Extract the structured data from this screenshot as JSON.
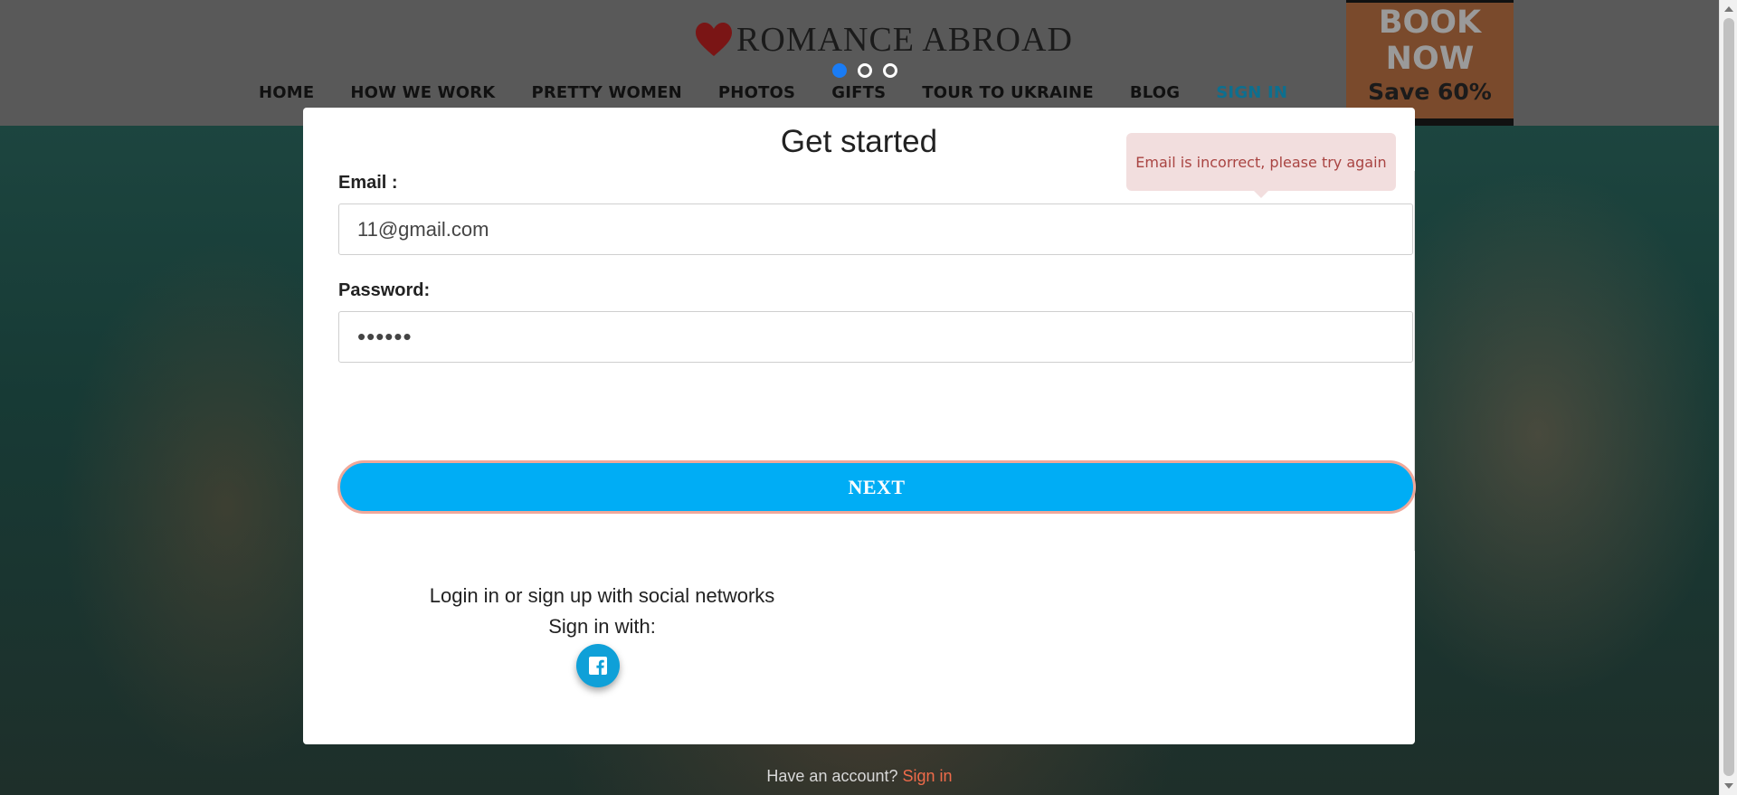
{
  "header": {
    "logo_text": "ROMANCE ABROAD",
    "carousel_dots": 3,
    "nav": [
      {
        "label": "HOME"
      },
      {
        "label": "HOW WE WORK"
      },
      {
        "label": "PRETTY WOMEN"
      },
      {
        "label": "PHOTOS"
      },
      {
        "label": "GIFTS"
      },
      {
        "label": "TOUR TO UKRAINE"
      },
      {
        "label": "BLOG"
      },
      {
        "label": "SIGN IN"
      }
    ],
    "promo": {
      "line1": "BOOK\nNOW",
      "line2": "Save 60%"
    }
  },
  "modal": {
    "title": "Get started",
    "email_label": "Email :",
    "email_value": "11@gmail.com",
    "password_label": "Password:",
    "password_value": "••••••",
    "next_label": "NEXT",
    "error_tooltip": "Email is incorrect, please try again",
    "social_line1": "Login in or sign up with social networks",
    "social_line2": "Sign in with:"
  },
  "footer": {
    "question": "Have an account?",
    "signin_link": "Sign in"
  },
  "colors": {
    "accent": "#00adf5",
    "active_dot": "#1a7cf5",
    "error_bg": "#f2dede",
    "error_text": "#a94442",
    "link": "#ef6b4a"
  }
}
